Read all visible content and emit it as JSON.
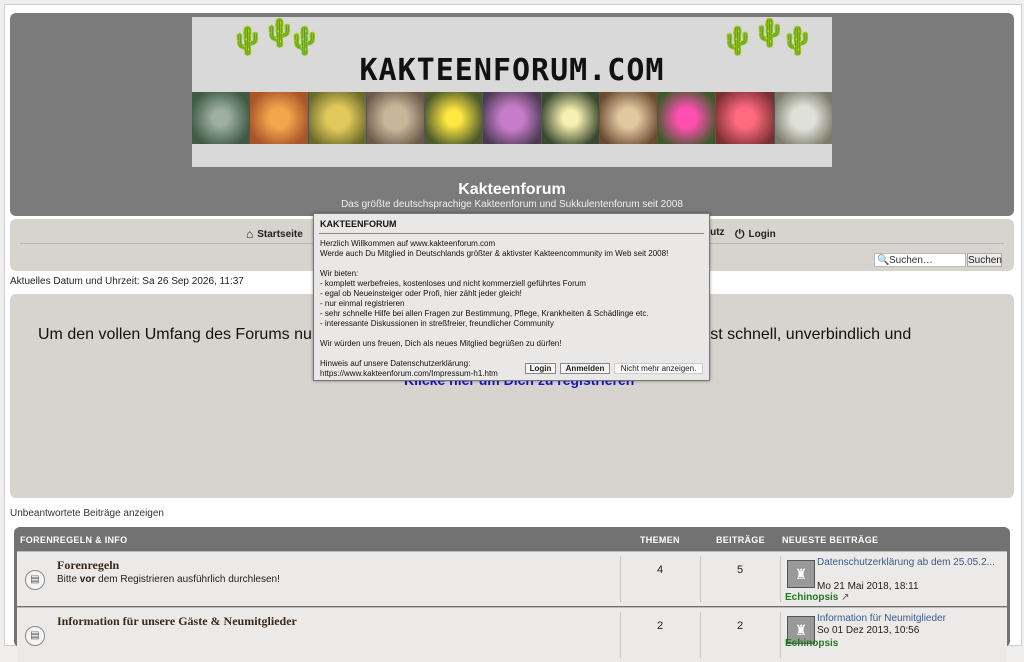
{
  "header": {
    "banner_title": "KAKTEENFORUM.COM",
    "site_title": "Kakteenforum",
    "site_subtitle": "Das größte deutschsprachige Kakteenforum und Sukkulentenforum seit 2008"
  },
  "nav": {
    "home": "Startseite",
    "privacy_partial": "hutz",
    "login": "Login"
  },
  "search": {
    "placeholder": "Suchen…",
    "button": "Suchen"
  },
  "datetime": "Aktuelles Datum und Uhrzeit: Sa 26 Sep 2026, 11:37",
  "promo": {
    "text": "Um den vollen Umfang des Forums nu                                                                         istrierung ist schnell, unverbindlich und",
    "link": "Klicke hier um Dich zu registrieren"
  },
  "unanswered": "Unbeantwortete Beiträge anzeigen",
  "table": {
    "headers": {
      "forum": "FORENREGELN & INFO",
      "topics": "THEMEN",
      "posts": "BEITRÄGE",
      "latest": "NEUESTE BEITRÄGE"
    },
    "rows": [
      {
        "name": "Forenregeln",
        "desc_pre": "Bitte ",
        "desc_bold": "vor",
        "desc_post": " dem Registrieren ausführlich durchlesen!",
        "topics": "4",
        "posts": "5",
        "last_title": "Datenschutzerklärung ab dem 25.05.2...",
        "last_date": "Mo 21 Mai 2018, 18:11",
        "last_user": "Echinopsis"
      },
      {
        "name": "Information für unsere Gäste & Neumitglieder",
        "topics": "2",
        "posts": "2",
        "last_title": "Information für Neumitglieder",
        "last_date": "So 01 Dez 2013, 10:56",
        "last_user": "Echinopsis"
      }
    ]
  },
  "modal": {
    "title": "KAKTEENFORUM",
    "body": "Herzlich Willkommen auf www.kakteenforum.com\nWerde auch Du Mitglied in Deutschlands größter & aktivster Kakteencommunity im Web seit 2008!\n\nWir bieten:\n- komplett werbefreies, kostenloses und nicht kommerziell geführtes Forum\n- egal ob Neueinsteiger oder Profi, hier zählt jeder gleich!\n- nur einmal registrieren\n- sehr schnelle Hilfe bei allen Fragen zur Bestimmung, Pflege, Krankheiten & Schädlinge etc.\n- interessante Diskussionen in streßfreier, freundlicher Community\n\nWir würden uns freuen, Dich als neues Mitglied begrüßen zu dürfen!\n\nHinweis auf unsere Datenschutzerklärung:\nhttps://www.kakteenforum.com/Impressum-h1.htm",
    "btn_login": "Login",
    "btn_register": "Anmelden",
    "btn_hide": "Nicht mehr anzeigen."
  },
  "colors": {
    "header_bg": "#7b7b7b",
    "panel_bg": "#d7d3cf",
    "link_blue": "#1515c9",
    "user_green": "#1f7a1f"
  }
}
